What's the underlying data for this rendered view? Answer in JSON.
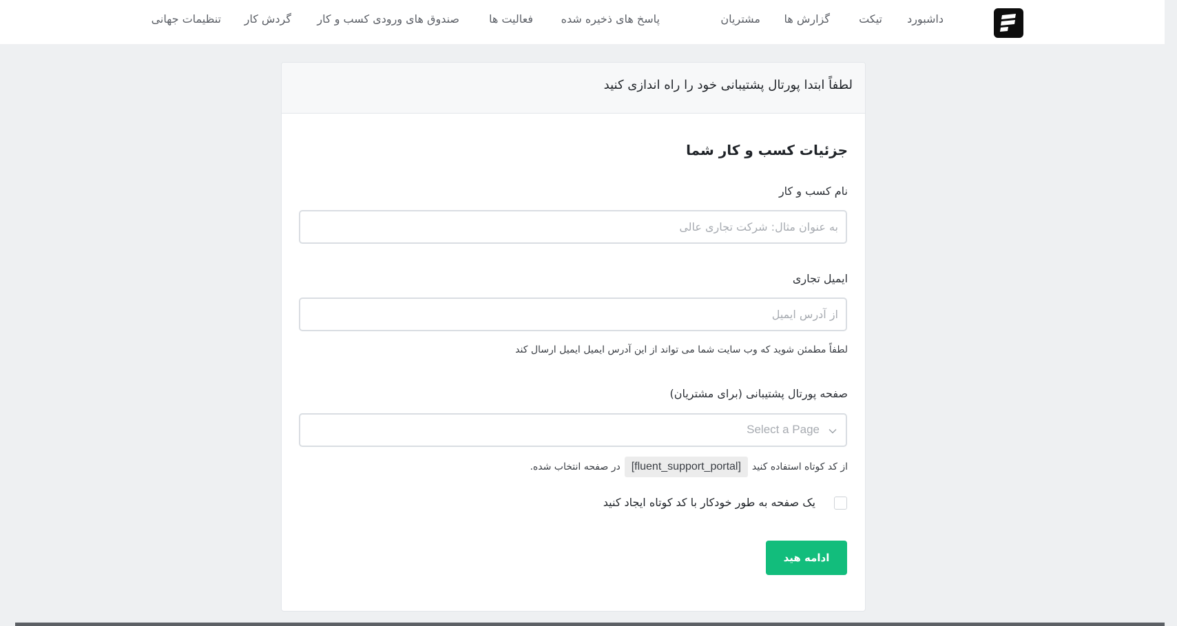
{
  "nav": {
    "items": [
      {
        "label": "داشبورد"
      },
      {
        "label": "تیکت"
      },
      {
        "label": "گزارش ها"
      },
      {
        "label": "مشتریان"
      },
      {
        "label": "پاسخ های ذخیره شده"
      },
      {
        "label": "فعالیت ها"
      },
      {
        "label": "صندوق های ورودی کسب و کار"
      },
      {
        "label": "گردش کار"
      },
      {
        "label": "تنظیمات جهانی"
      }
    ]
  },
  "card": {
    "header_title": "لطفاً ابتدا پورتال پشتیبانی خود را راه اندازی کنید",
    "section_title": "جزئیات کسب و کار شما",
    "business_name": {
      "label": "نام کسب و کار",
      "placeholder": "به عنوان مثال: شرکت تجاری عالی",
      "value": ""
    },
    "business_email": {
      "label": "ایمیل تجاری",
      "placeholder": "از آدرس ایمیل",
      "value": "",
      "help": "لطفاً مطمئن شوید که وب سایت شما می تواند از این آدرس ایمیل ایمیل ارسال کند"
    },
    "portal_page": {
      "label": "صفحه پورتال پشتیبانی (برای مشتریان)",
      "placeholder": "Select a Page",
      "help_before": "از کد کوتاه استفاده کنید",
      "shortcode": "[fluent_support_portal]",
      "help_after": "در صفحه انتخاب شده."
    },
    "auto_create": {
      "label": "یک صفحه به طور خودکار با کد کوتاه ایجاد کنید",
      "checked": false
    },
    "continue_label": "ادامه هید"
  },
  "colors": {
    "accent": "#12bd7c",
    "background": "#eef0f2"
  }
}
